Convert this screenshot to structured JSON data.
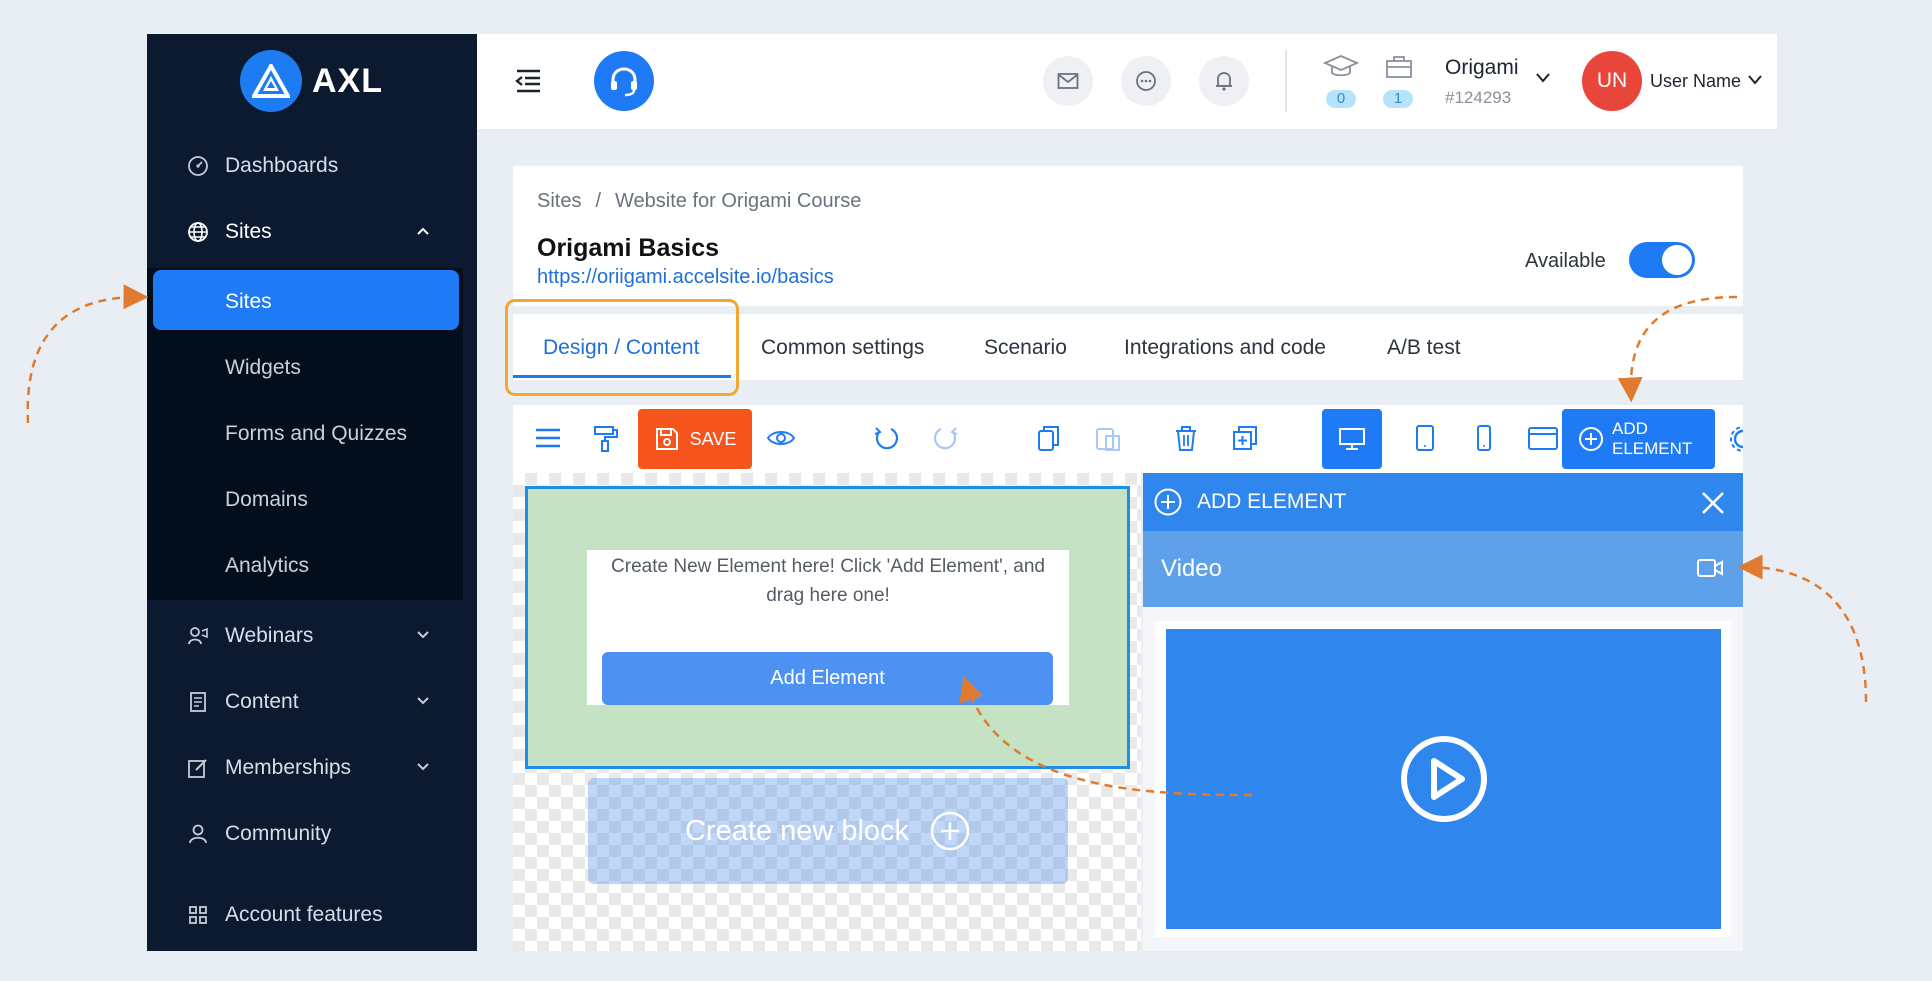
{
  "brand": {
    "name": "AXL"
  },
  "sidebar": {
    "items": [
      {
        "label": "Dashboards",
        "icon": "dashboard-icon"
      },
      {
        "label": "Sites",
        "icon": "globe-icon"
      },
      {
        "label": "Webinars",
        "icon": "webinar-icon"
      },
      {
        "label": "Content",
        "icon": "content-icon"
      },
      {
        "label": "Memberships",
        "icon": "edit-icon"
      },
      {
        "label": "Community",
        "icon": "user-icon"
      },
      {
        "label": "Account features",
        "icon": "grid-icon"
      }
    ],
    "sub_items": [
      {
        "label": "Sites"
      },
      {
        "label": "Widgets"
      },
      {
        "label": "Forms and Quizzes"
      },
      {
        "label": "Domains"
      },
      {
        "label": "Analytics"
      }
    ]
  },
  "topbar": {
    "courses_count": "0",
    "products_count": "1",
    "account_name": "Origami",
    "account_id": "#124293",
    "avatar_initials": "UN",
    "user_name": "User Name"
  },
  "page": {
    "breadcrumb_root": "Sites",
    "breadcrumb_sep": "/",
    "breadcrumb_current": "Website for Origami Course",
    "title": "Origami Basics",
    "url": "https://oriigami.accelsite.io/basics",
    "available_label": "Available",
    "available_on": true
  },
  "tabs": [
    {
      "label": "Design / Content",
      "active": true
    },
    {
      "label": "Common settings"
    },
    {
      "label": "Scenario"
    },
    {
      "label": "Integrations and code"
    },
    {
      "label": "A/B test"
    }
  ],
  "toolbar": {
    "save_label": "SAVE",
    "add_element_line1": "ADD",
    "add_element_line2": "ELEMENT"
  },
  "canvas": {
    "prompt_text": "Create New Element here! Click 'Add Element', and drag here one!",
    "add_element_button": "Add Element",
    "create_block_label": "Create new block"
  },
  "add_panel": {
    "title": "ADD ELEMENT",
    "category": "Video"
  },
  "colors": {
    "sidebar_bg": "#0b1a2e",
    "accent": "#1f7bf5",
    "save": "#f5541d",
    "highlight": "#f0a830",
    "avatar": "#e8463a"
  }
}
